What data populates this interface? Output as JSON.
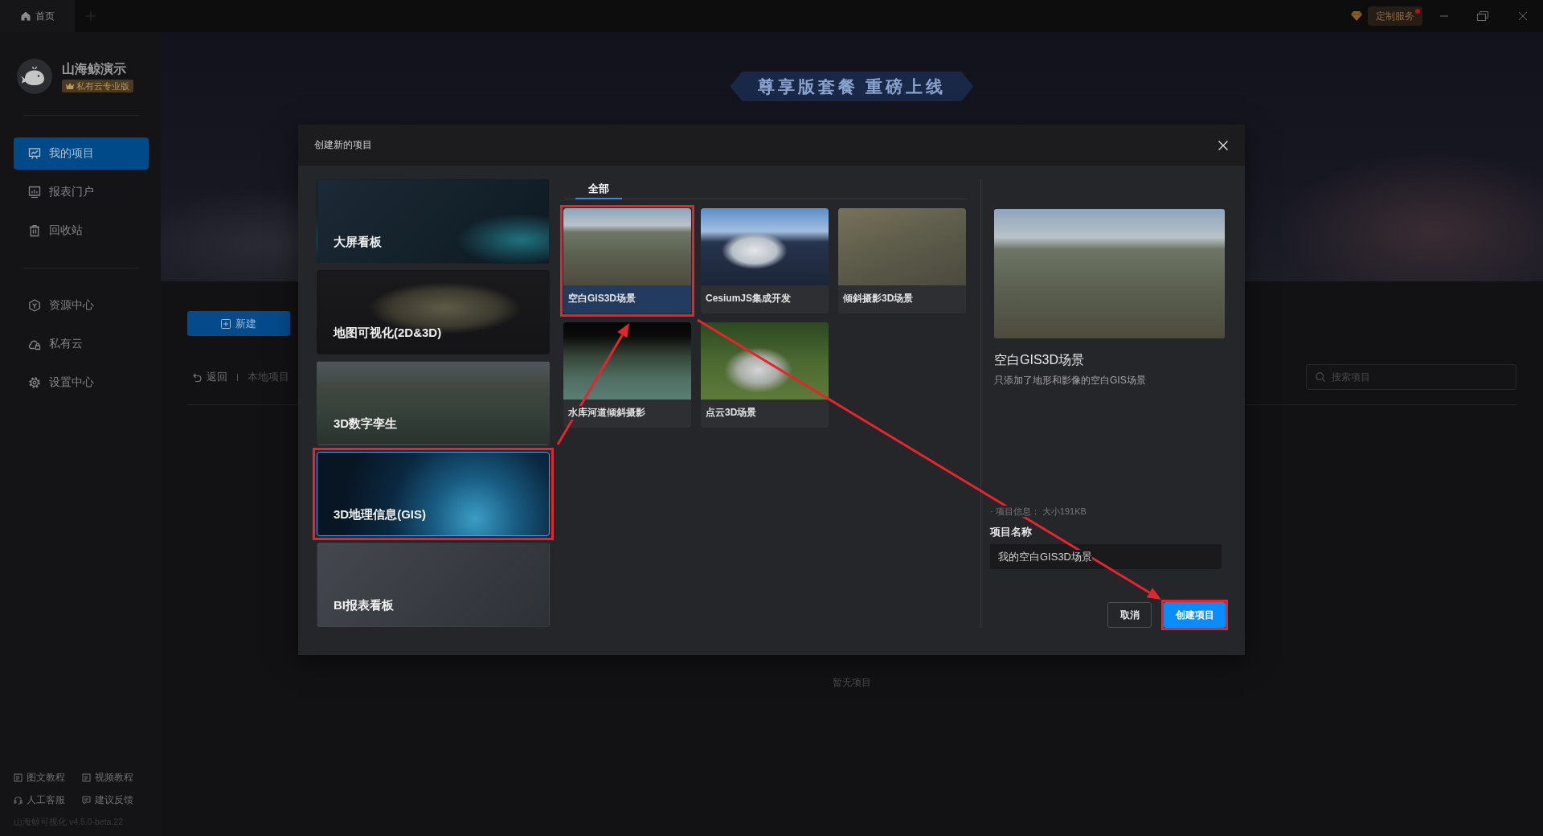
{
  "title_bar": {
    "tabs": [
      {
        "label": "首页",
        "selected": true
      }
    ],
    "service": {
      "label": "定制服务",
      "notification": true
    }
  },
  "sidebar": {
    "user": {
      "name": "山海鲸演示",
      "plan": "私有云专业版"
    },
    "sections": [
      {
        "items": [
          {
            "label": "我的项目",
            "selected": true
          },
          {
            "label": "报表门户",
            "selected": false
          },
          {
            "label": "回收站",
            "selected": false
          }
        ]
      },
      {
        "items": [
          {
            "label": "资源中心",
            "selected": false
          },
          {
            "label": "私有云",
            "selected": false
          },
          {
            "label": "设置中心",
            "selected": false
          }
        ]
      }
    ],
    "footer_links": [
      "图文教程",
      "视频教程",
      "人工客服",
      "建议反馈"
    ],
    "version": "山海鲸可视化 v4.5.0-beta.22"
  },
  "main": {
    "banner": {
      "title": "尊享版套餐 重磅上线"
    },
    "new_button": "新建",
    "breadcrumb": {
      "back": "返回",
      "current": "本地项目"
    },
    "search": {
      "placeholder": "搜索项目"
    },
    "empty_text": "暂无项目"
  },
  "dialog": {
    "title": "创建新的项目",
    "categories": [
      {
        "label": "大屏看板",
        "selected": false,
        "highlighted": false
      },
      {
        "label": "地图可视化(2D&3D)",
        "selected": false,
        "highlighted": false
      },
      {
        "label": "3D数字孪生",
        "selected": false,
        "highlighted": false
      },
      {
        "label": "3D地理信息(GIS)",
        "selected": true,
        "highlighted": true
      },
      {
        "label": "BI报表看板",
        "selected": false,
        "highlighted": false
      }
    ],
    "tabs": [
      {
        "label": "全部",
        "selected": true
      }
    ],
    "templates": [
      {
        "label": "空白GIS3D场景",
        "selected": true,
        "highlighted": true
      },
      {
        "label": "CesiumJS集成开发",
        "selected": false,
        "highlighted": false
      },
      {
        "label": "倾斜摄影3D场景",
        "selected": false,
        "highlighted": false
      },
      {
        "label": "水库河道倾斜摄影",
        "selected": false,
        "highlighted": false
      },
      {
        "label": "点云3D场景",
        "selected": false,
        "highlighted": false
      }
    ],
    "detail": {
      "title": "空白GIS3D场景",
      "description": "只添加了地形和影像的空白GIS场景",
      "info": "· 项目信息： 大小191KB",
      "name_label": "项目名称",
      "name_value": "我的空白GIS3D场景"
    },
    "buttons": [
      {
        "label": "取消",
        "kind": "secondary",
        "highlighted": false
      },
      {
        "label": "创建项目",
        "kind": "primary",
        "highlighted": true
      }
    ]
  }
}
